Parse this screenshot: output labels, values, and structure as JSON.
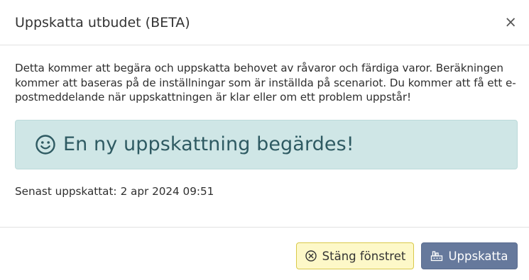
{
  "dialog": {
    "title": "Uppskatta utbudet (BETA)",
    "close_glyph": "×",
    "close_icon": "close-icon"
  },
  "body": {
    "description": "Detta kommer att begära och uppskatta behovet av råvaror och färdiga varor. Beräkningen kommer att baseras på de inställningar som är inställda på scenariot. Du kommer att få ett e-postmeddelande när uppskattningen är klar eller om ett problem uppstår!",
    "alert": {
      "icon": "smile-icon",
      "text": "En ny uppskattning begärdes!"
    },
    "last_estimated_label": "Senast uppskattat:",
    "last_estimated_value": "2 apr 2024 09:51"
  },
  "footer": {
    "close_button": {
      "label": "Stäng fönstret",
      "icon": "circle-x-icon"
    },
    "estimate_button": {
      "label": "Uppskatta",
      "icon": "factory-icon"
    }
  },
  "colors": {
    "alert_background": "#cfe6e6",
    "alert_text": "#2e5a62",
    "close_button_background": "#fdf8c8",
    "estimate_button_background": "#66799c"
  }
}
